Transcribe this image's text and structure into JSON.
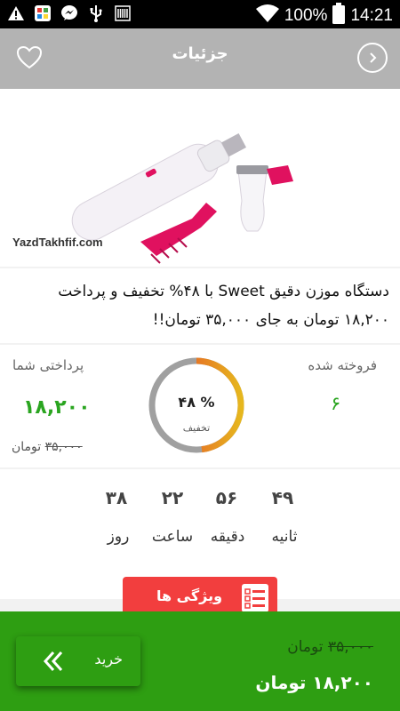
{
  "status_bar": {
    "battery": "100%",
    "time": "14:21"
  },
  "header": {
    "title": "جزئیات"
  },
  "product": {
    "watermark": "YazdTakhfif.com"
  },
  "title": "دستگاه موزن دقیق Sweet با ۴۸% تخفیف و پرداخت ۱۸,۲۰۰ تومان به جای ۳۵,۰۰۰ تومان!!",
  "stats": {
    "sold_label": "فروخته شده",
    "sold_value": "۶",
    "pay_label": "پرداختی شما",
    "pay_value": "۱۸,۲۰۰",
    "old_price": "۳۵,۰۰۰",
    "currency": "تومان",
    "discount_percent": "۴۸ %",
    "discount_label": "تخفیف",
    "discount_fraction": 0.48
  },
  "countdown": {
    "items": [
      {
        "value": "۴۹",
        "label": "ثانیه"
      },
      {
        "value": "۵۶",
        "label": "دقیقه"
      },
      {
        "value": "۲۲",
        "label": "ساعت"
      },
      {
        "value": "۳۸",
        "label": "روز"
      }
    ]
  },
  "features_button": {
    "label": "ویژگی ها"
  },
  "bottom_bar": {
    "buy_label": "خرید",
    "old_price": "۳۵,۰۰۰",
    "new_price": "۱۸,۲۰۰",
    "currency": "تومان"
  },
  "colors": {
    "accent_green": "#2e9e12",
    "price_green": "#2aa520",
    "features_red": "#f23e3e",
    "header_gray": "#b3b3b3"
  }
}
